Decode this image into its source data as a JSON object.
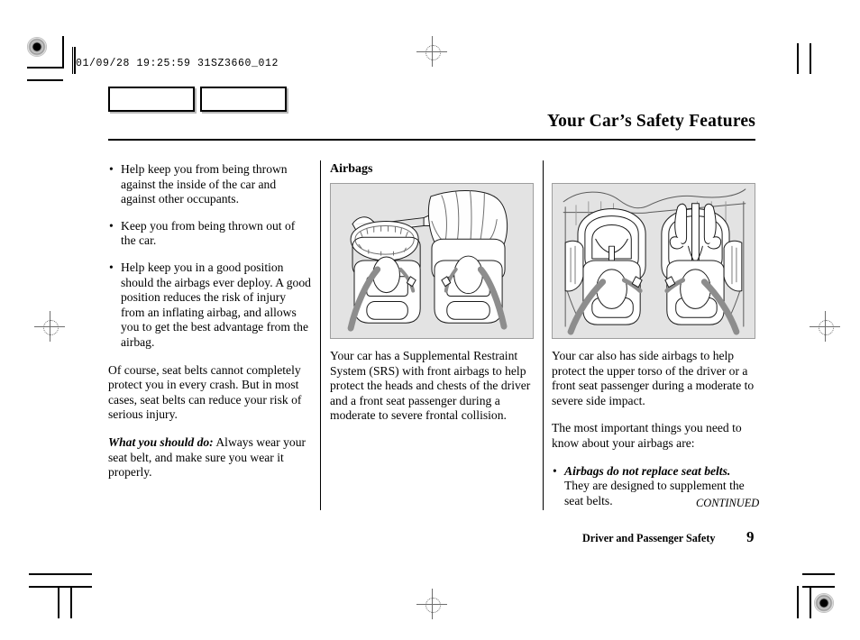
{
  "print_marks": {
    "slug": "01/09/28 19:25:59 31SZ3660_012"
  },
  "header": {
    "title": "Your Car’s Safety Features"
  },
  "columns": {
    "left": {
      "bullets": [
        "Help keep you from being thrown against the inside of the car and against other occupants.",
        "Keep you from being thrown out of the car.",
        "Help keep you in a good position should the airbags ever deploy. A good position reduces the risk of injury from an inflating airbag, and allows you to get the best advantage from the airbag."
      ],
      "paragraph": "Of course, seat belts cannot completely protect you in every crash. But in most cases, seat belts can reduce your risk of serious injury.",
      "advice_lead": "What you should do:",
      "advice_rest": " Always wear your seat belt, and make sure you wear it properly."
    },
    "middle": {
      "subhead": "Airbags",
      "figure_caption": "front-airbags-deployed-illustration",
      "paragraph": "Your car has a Supplemental Restraint System (SRS) with front airbags to help protect the heads and chests of the driver and a front seat passenger during a moderate to severe frontal collision."
    },
    "right": {
      "figure_caption": "side-airbags-deployed-illustration",
      "paragraph_1": "Your car also has side airbags to help protect the upper torso of the driver or a front seat passenger during a moderate to severe side impact.",
      "paragraph_2": "The most important things you need to know about your airbags are:",
      "bullet_lead": "Airbags do not replace seat belts.",
      "bullet_rest": " They are designed to supplement the seat belts.",
      "continued": "CONTINUED"
    }
  },
  "footer": {
    "section": "Driver and Passenger Safety",
    "page_number": "9"
  },
  "colors": {
    "figure_background": "#e3e3e3",
    "figure_border": "#9e9e9e",
    "text": "#000000",
    "belt_gray": "#8d8d8d"
  }
}
